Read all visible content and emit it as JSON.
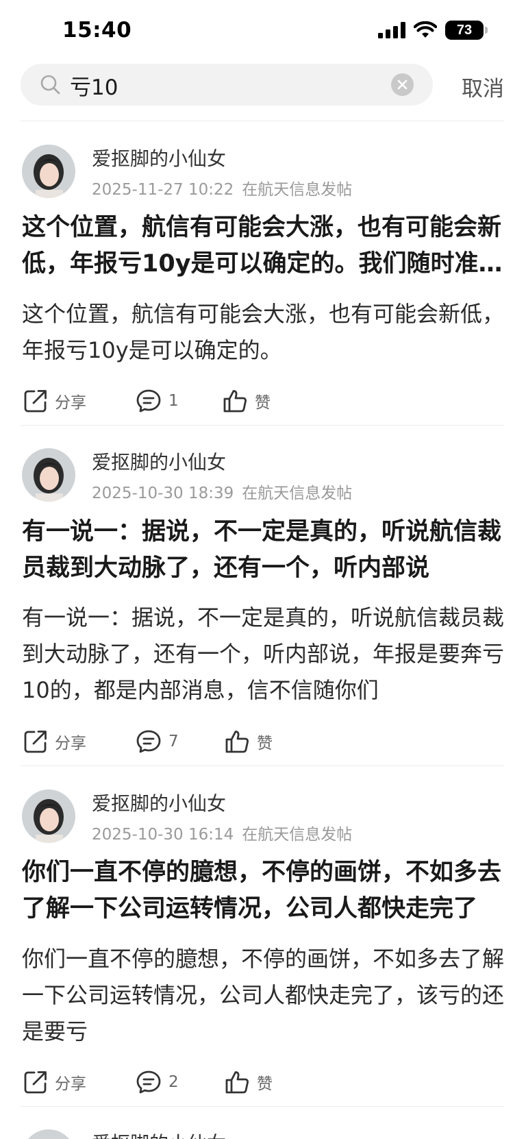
{
  "status_bar": {
    "time": "15:40",
    "battery": "73"
  },
  "search": {
    "query": "亏10",
    "cancel_label": "取消"
  },
  "posts": [
    {
      "author": "爱抠脚的小仙女",
      "time": "2025-11-27 10:22",
      "forum": "在航天信息发帖",
      "title": "这个位置，航信有可能会大涨，也有可能会新低，年报亏10y是可以确定的。我们随时准备好",
      "body": "这个位置，航信有可能会大涨，也有可能会新低，年报亏10y是可以确定的。",
      "share_label": "分享",
      "comments": "1",
      "like_label": "赞"
    },
    {
      "author": "爱抠脚的小仙女",
      "time": "2025-10-30 18:39",
      "forum": "在航天信息发帖",
      "title": "有一说一：据说，不一定是真的，听说航信裁员裁到大动脉了，还有一个，听内部说",
      "body": "有一说一：据说，不一定是真的，听说航信裁员裁到大动脉了，还有一个，听内部说，年报是要奔亏10的，都是内部消息，信不信随你们",
      "share_label": "分享",
      "comments": "7",
      "like_label": "赞"
    },
    {
      "author": "爱抠脚的小仙女",
      "time": "2025-10-30 16:14",
      "forum": "在航天信息发帖",
      "title": "你们一直不停的臆想，不停的画饼，不如多去了解一下公司运转情况，公司人都快走完了",
      "body": "你们一直不停的臆想，不停的画饼，不如多去了解一下公司运转情况，公司人都快走完了，该亏的还是要亏",
      "share_label": "分享",
      "comments": "2",
      "like_label": "赞"
    },
    {
      "author": "爱抠脚的小仙女"
    }
  ]
}
